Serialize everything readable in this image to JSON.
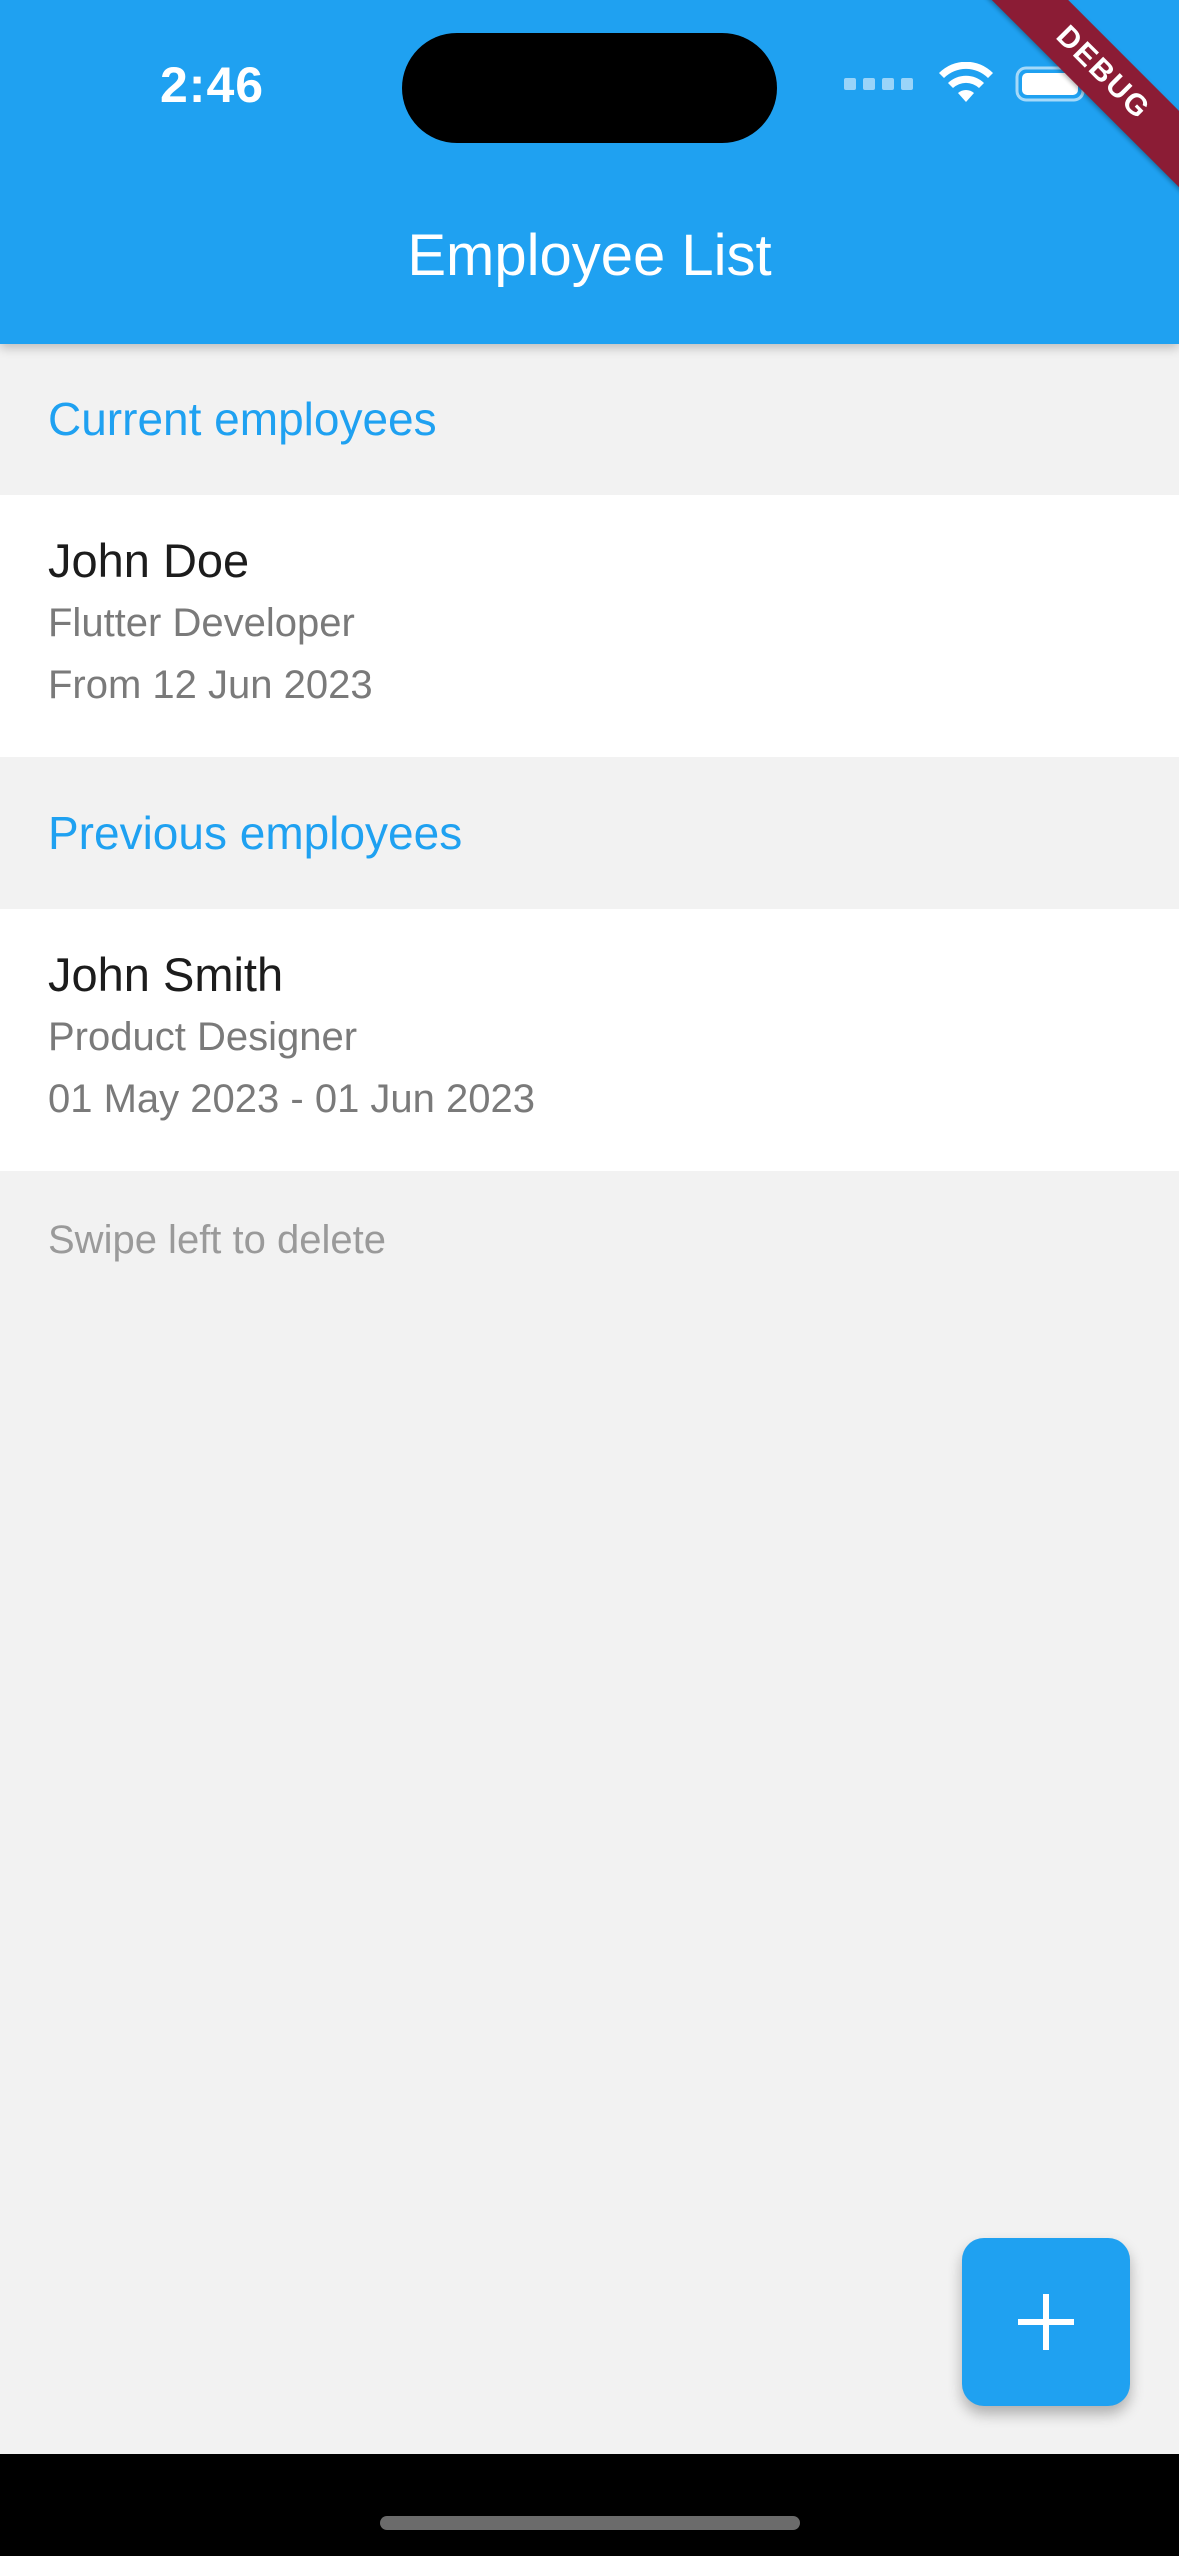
{
  "status_bar": {
    "time": "2:46",
    "debug_label": "DEBUG"
  },
  "app_bar": {
    "title": "Employee List",
    "color": "#1fa1f1"
  },
  "sections": {
    "current": {
      "header": "Current employees",
      "employees": [
        {
          "name": "John Doe",
          "role": "Flutter Developer",
          "dates": "From 12 Jun 2023"
        }
      ]
    },
    "previous": {
      "header": "Previous employees",
      "employees": [
        {
          "name": "John Smith",
          "role": "Product Designer",
          "dates": "01 May 2023 - 01 Jun 2023"
        }
      ]
    }
  },
  "hint": "Swipe left to delete",
  "fab": {
    "icon": "plus-icon"
  }
}
